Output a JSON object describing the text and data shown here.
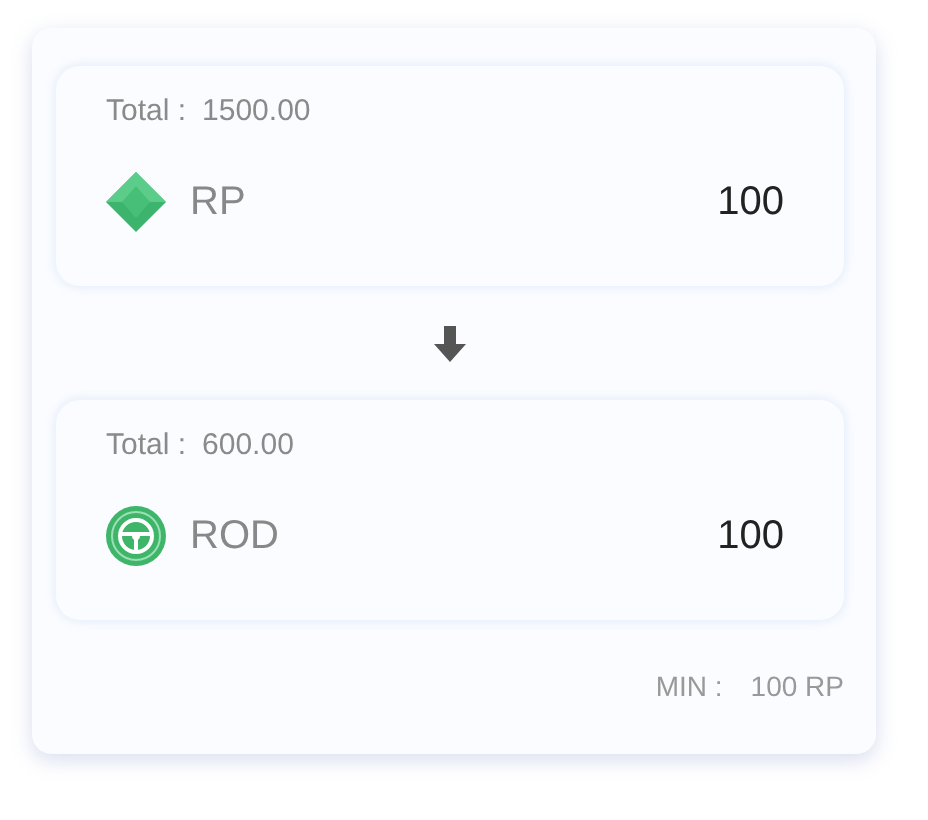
{
  "accounts": [
    {
      "total_label": "Total :",
      "total": "1500.00",
      "icon": {
        "kind": "gem"
      },
      "currency": "RP",
      "amount": "100"
    },
    {
      "total_label": "Total :",
      "total": "600.00",
      "icon": {
        "kind": "wheel"
      },
      "currency": "ROD",
      "amount": "100"
    }
  ],
  "minimum": {
    "label": "MIN :",
    "value": "100 RP"
  }
}
